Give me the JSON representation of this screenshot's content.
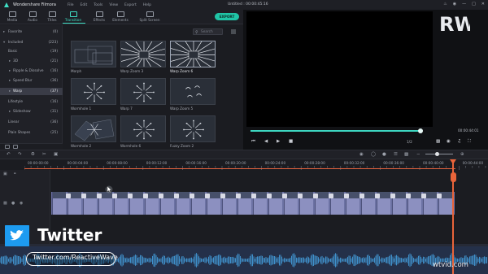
{
  "title_bar": {
    "app_name": "Wondershare Filmora",
    "menus": [
      "File",
      "Edit",
      "Tools",
      "View",
      "Export",
      "Help"
    ],
    "project": "Untitled : 00:00:45:16",
    "controls": [
      "bell-icon",
      "user-icon",
      "minimize-icon",
      "maximize-icon",
      "close-icon"
    ]
  },
  "tabs": [
    {
      "label": "Media",
      "icon": "media-icon",
      "active": false
    },
    {
      "label": "Audio",
      "icon": "audio-icon",
      "active": false
    },
    {
      "label": "Titles",
      "icon": "titles-icon",
      "active": false
    },
    {
      "label": "Transition",
      "icon": "transition-icon",
      "active": true
    },
    {
      "label": "Effects",
      "icon": "effects-icon",
      "active": false
    },
    {
      "label": "Elements",
      "icon": "elements-icon",
      "active": false
    },
    {
      "label": "Split Screen",
      "icon": "split-screen-icon",
      "active": false
    }
  ],
  "export_label": "EXPORT",
  "accent": "#20c4a6",
  "sidebar": {
    "items": [
      {
        "name": "Favorite",
        "count": "(0)",
        "sub": false,
        "active": false,
        "tri": "▸"
      },
      {
        "name": "Included",
        "count": "(223)",
        "sub": false,
        "active": false,
        "tri": "▾"
      },
      {
        "name": "Basic",
        "count": "(19)",
        "sub": false,
        "active": false,
        "tri": ""
      },
      {
        "name": "3D",
        "count": "(21)",
        "sub": true,
        "active": false,
        "tri": "▸"
      },
      {
        "name": "Ripple & Dissolve",
        "count": "(16)",
        "sub": true,
        "active": false,
        "tri": "▸"
      },
      {
        "name": "Speed Blur",
        "count": "(36)",
        "sub": true,
        "active": false,
        "tri": "▸"
      },
      {
        "name": "Warp",
        "count": "(37)",
        "sub": true,
        "active": true,
        "tri": "▸"
      },
      {
        "name": "Lifestyle",
        "count": "(16)",
        "sub": false,
        "active": false,
        "tri": ""
      },
      {
        "name": "Slideshow",
        "count": "(31)",
        "sub": true,
        "active": false,
        "tri": "▸"
      },
      {
        "name": "Linear",
        "count": "(36)",
        "sub": false,
        "active": false,
        "tri": ""
      },
      {
        "name": "Plain Shapes",
        "count": "(25)",
        "sub": false,
        "active": false,
        "tri": ""
      }
    ],
    "bottom_icons": [
      "add-folder-icon",
      "folder-icon"
    ]
  },
  "library": {
    "search_placeholder": "Search",
    "thumbs": [
      {
        "label": "Morph",
        "selected": false,
        "kind": "morph"
      },
      {
        "label": "Warp Zoom 3",
        "selected": false,
        "kind": "rays"
      },
      {
        "label": "Warp Zoom 6",
        "selected": true,
        "kind": "rays"
      },
      {
        "label": "Wormhole 1",
        "selected": false,
        "kind": "arrows"
      },
      {
        "label": "Warp 7",
        "selected": false,
        "kind": "arrows"
      },
      {
        "label": "Warp Zoom 5",
        "selected": false,
        "kind": "swirl"
      },
      {
        "label": "Wormhole 2",
        "selected": false,
        "kind": "tiles"
      },
      {
        "label": "Wormhole 6",
        "selected": false,
        "kind": "arrows"
      },
      {
        "label": "Fuzzy Zoom 2",
        "selected": false,
        "kind": "arrows"
      }
    ]
  },
  "preview": {
    "time": "00:00:44:01",
    "ratio": "1/2",
    "progress": 0.98,
    "watermark_logo": "RW"
  },
  "ruler": {
    "labels": [
      "00:00:00:00",
      "00:00:04:00",
      "00:00:08:00",
      "00:00:12:00",
      "00:00:16:00",
      "00:00:20:00",
      "00:00:24:00",
      "00:00:28:00",
      "00:00:32:00",
      "00:00:36:00",
      "00:00:40:00",
      "00:00:44:00"
    ]
  },
  "overlay": {
    "twitter_title": "Twitter",
    "twitter_url": "Twitter.com/ReactiveWave",
    "twitter_color": "#1d9bf0",
    "watermark": "wtvid.com"
  },
  "timeline": {
    "clip_count": 26
  }
}
